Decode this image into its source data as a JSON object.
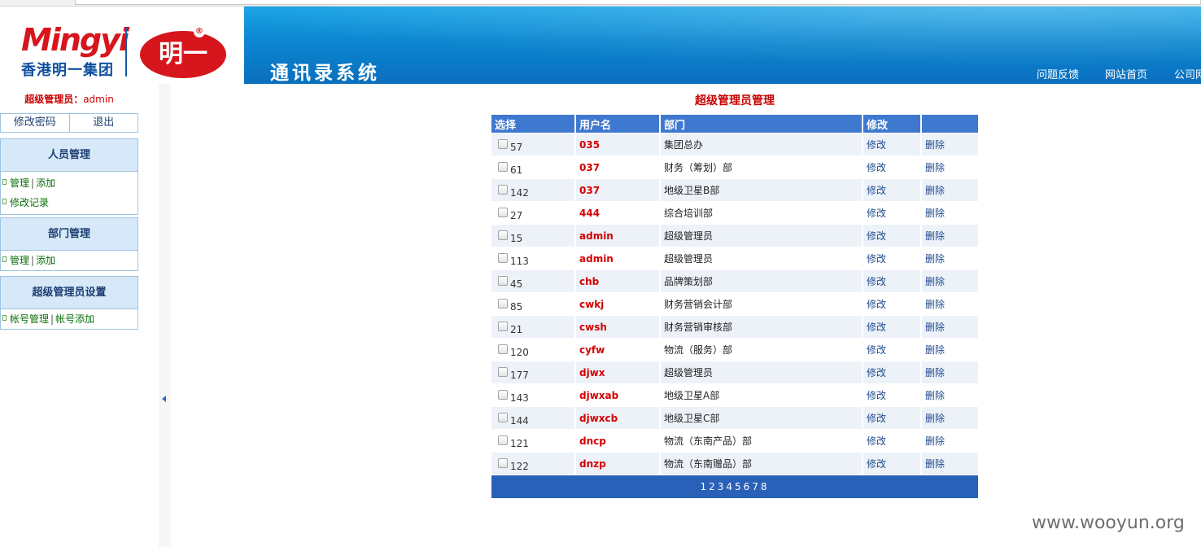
{
  "header": {
    "logo_text_en": "Mingyi",
    "logo_text_cn": "香港明一集团",
    "logo_seal": "明一",
    "logo_reg": "®",
    "system_title": "通讯录系统",
    "nav": [
      "问题反馈",
      "网站首页",
      "公司网"
    ]
  },
  "sidebar": {
    "admin_label": "超级管理员：",
    "admin_name": "admin",
    "change_password": "修改密码",
    "logout": "退出",
    "panels": [
      {
        "title": "人员管理",
        "links": [
          [
            "管理",
            "添加"
          ],
          [
            "修改记录"
          ]
        ]
      },
      {
        "title": "部门管理",
        "links": [
          [
            "管理",
            "添加"
          ]
        ]
      },
      {
        "title": "超级管理员设置",
        "links": [
          [
            "帐号管理",
            "帐号添加"
          ]
        ]
      }
    ],
    "link_separator": "|"
  },
  "main": {
    "title": "超级管理员管理",
    "columns": [
      "选择",
      "用户名",
      "部门",
      "修改",
      ""
    ],
    "edit_label": "修改",
    "delete_label": "删除",
    "rows": [
      {
        "id": "57",
        "user": "035",
        "dept": "集团总办"
      },
      {
        "id": "61",
        "user": "037",
        "dept": "财务（筹划）部"
      },
      {
        "id": "142",
        "user": "037",
        "dept": "地级卫星B部"
      },
      {
        "id": "27",
        "user": "444",
        "dept": "综合培训部"
      },
      {
        "id": "15",
        "user": "admin",
        "dept": "超级管理员"
      },
      {
        "id": "113",
        "user": "admin",
        "dept": "超级管理员"
      },
      {
        "id": "45",
        "user": "chb",
        "dept": "品牌策划部"
      },
      {
        "id": "85",
        "user": "cwkj",
        "dept": "财务营销会计部"
      },
      {
        "id": "21",
        "user": "cwsh",
        "dept": "财务营销审核部"
      },
      {
        "id": "120",
        "user": "cyfw",
        "dept": "物流（服务）部"
      },
      {
        "id": "177",
        "user": "djwx",
        "dept": "超级管理员"
      },
      {
        "id": "143",
        "user": "djwxab",
        "dept": "地级卫星A部"
      },
      {
        "id": "144",
        "user": "djwxcb",
        "dept": "地级卫星C部"
      },
      {
        "id": "121",
        "user": "dncp",
        "dept": "物流（东南产品）部"
      },
      {
        "id": "122",
        "user": "dnzp",
        "dept": "物流（东南赠品）部"
      }
    ],
    "pages": [
      "1",
      "2",
      "3",
      "4",
      "5",
      "6",
      "7",
      "8"
    ]
  },
  "watermark": "www.wooyun.org"
}
